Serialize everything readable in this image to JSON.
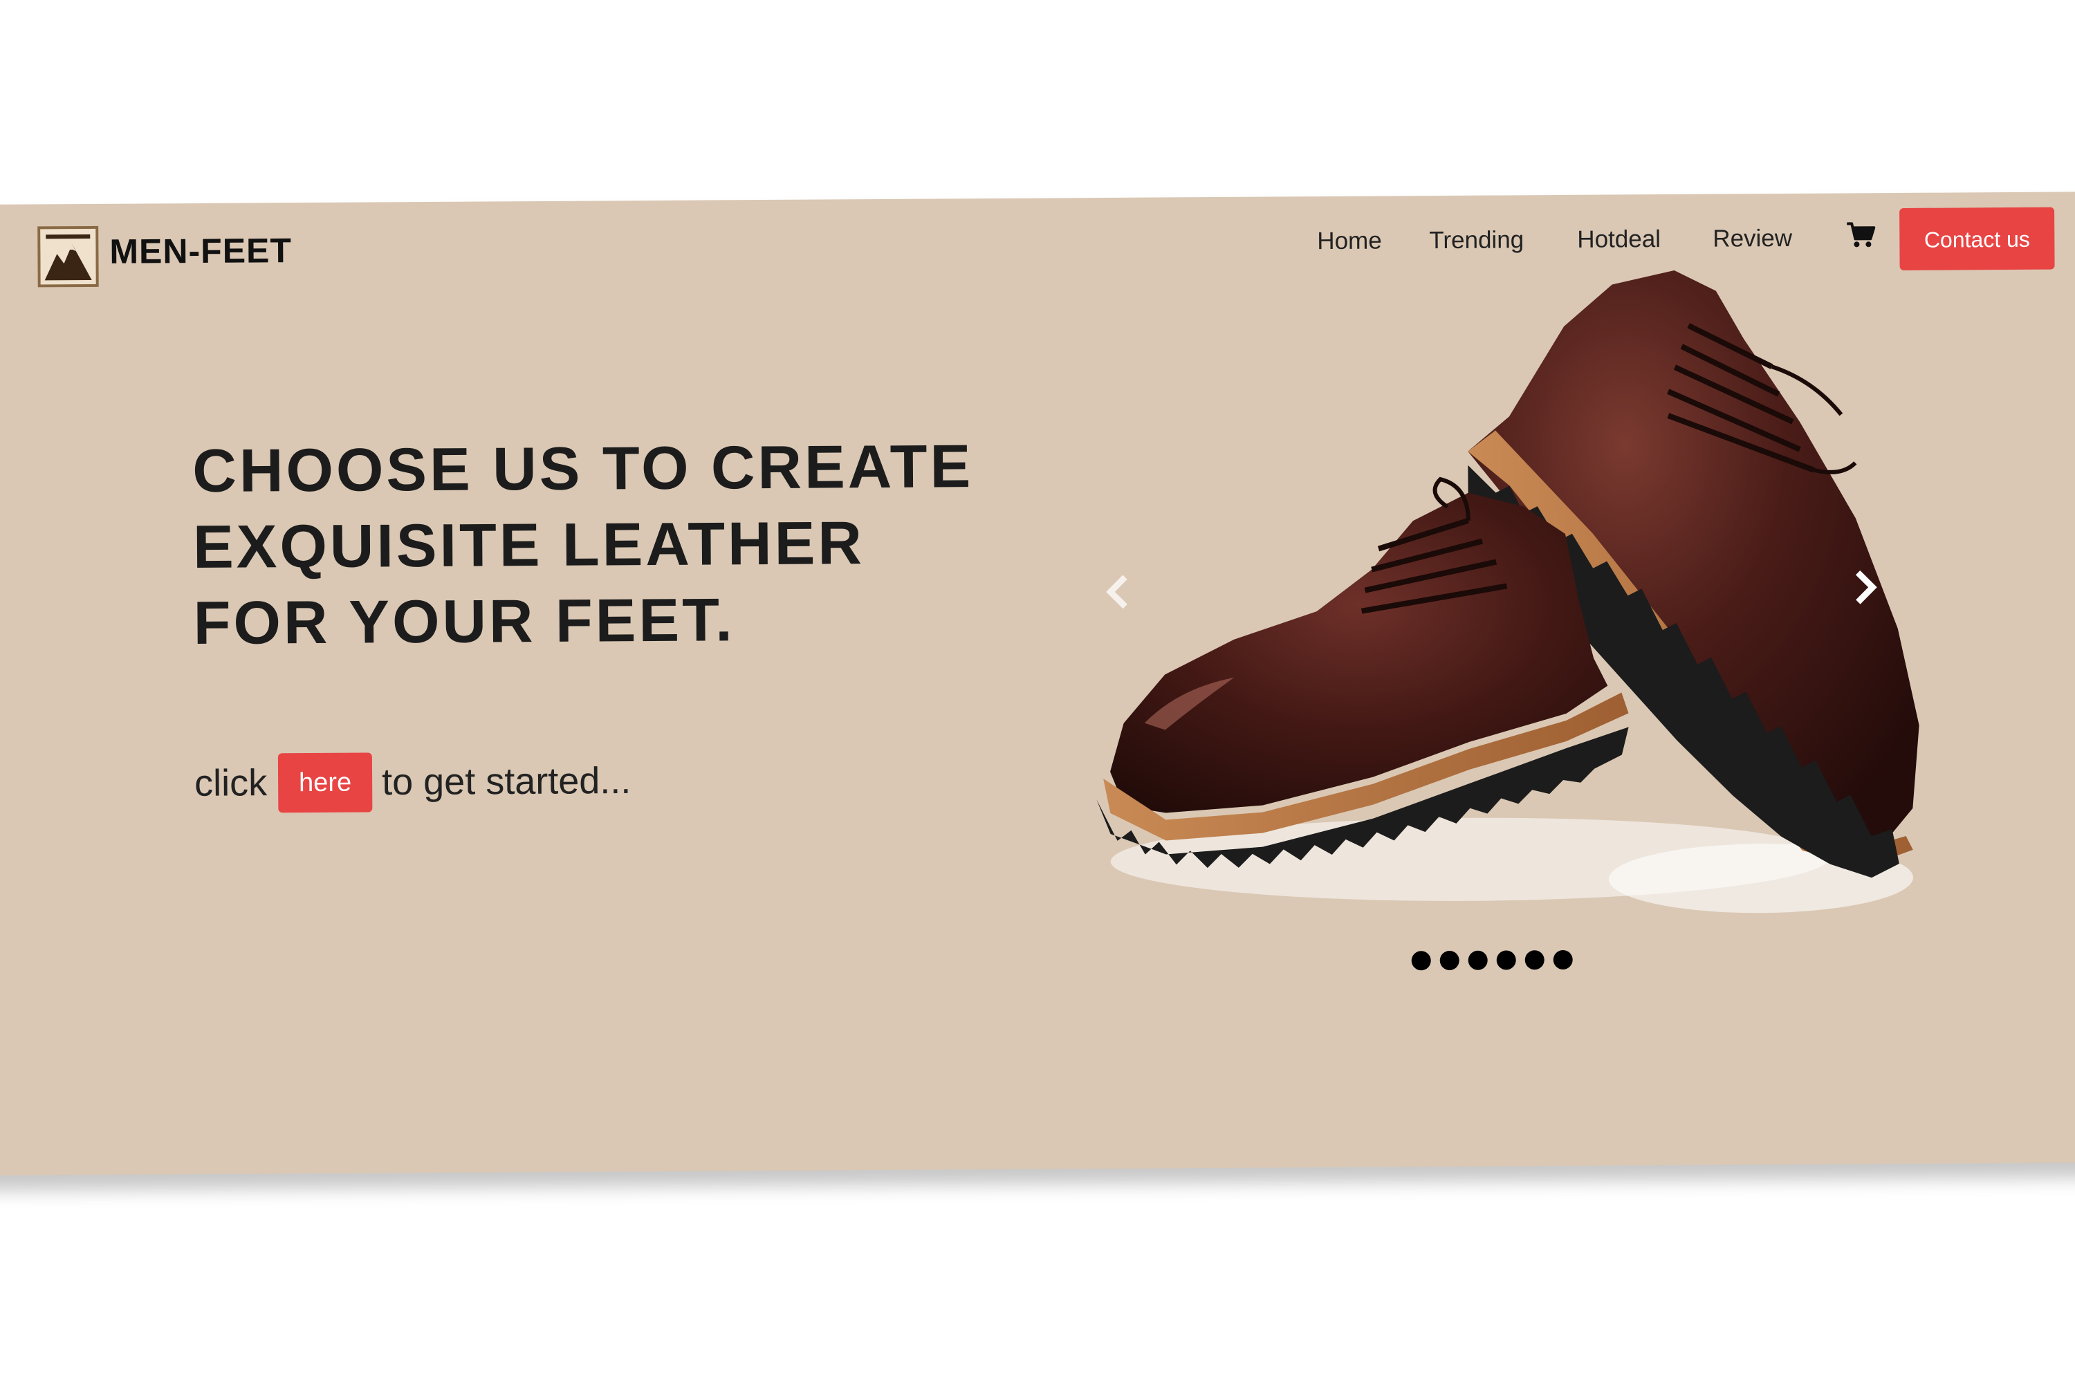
{
  "brand": {
    "name": "MEN-FEET",
    "logo_icon": "mountain-logo-icon"
  },
  "nav": {
    "items": [
      {
        "label": "Home"
      },
      {
        "label": "Trending"
      },
      {
        "label": "Hotdeal"
      },
      {
        "label": "Review"
      }
    ],
    "cart_icon": "shopping-cart-icon",
    "contact_label": "Contact us"
  },
  "hero": {
    "headline": "CHOOSE US TO CREATE EXQUISITE LEATHER FOR YOUR FEET.",
    "cta_prefix": "click",
    "cta_button": "here",
    "cta_suffix": "to get started..."
  },
  "carousel": {
    "image_alt": "Pair of brown leather derby shoes with lug soles",
    "prev_icon": "chevron-left-icon",
    "next_icon": "chevron-right-icon",
    "slide_count": 6
  },
  "colors": {
    "background": "#dac8b4",
    "accent": "#e84444",
    "headline": "#1c1c1c"
  }
}
